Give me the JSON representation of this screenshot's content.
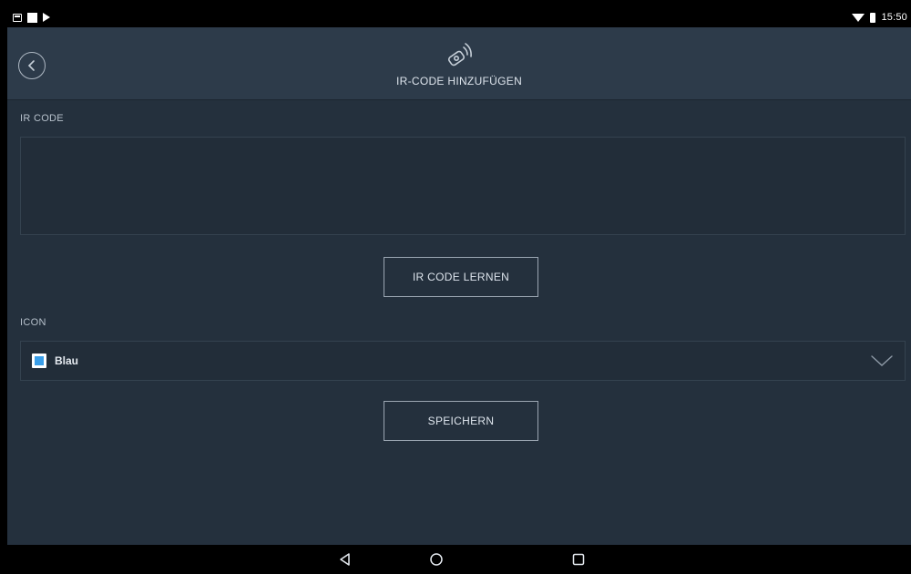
{
  "status_bar": {
    "time": "15:50",
    "icons": [
      "image-notification-icon",
      "square-notification-icon",
      "play-notification-icon",
      "wifi-icon",
      "battery-icon"
    ]
  },
  "header": {
    "title": "IR-CODE HINZUFÜGEN",
    "back_icon": "chevron-left-circle-icon",
    "header_icon": "ir-remote-icon"
  },
  "form": {
    "ir_code": {
      "label": "IR CODE",
      "value": "",
      "placeholder": ""
    },
    "learn_button": "IR CODE LERNEN",
    "icon": {
      "label": "ICON",
      "selected": "Blau",
      "swatch_color": "#3a9ee8"
    },
    "save_button": "SPEICHERN"
  },
  "colors": {
    "background": "#24303d",
    "header": "#2d3b4a",
    "field": "#222d39",
    "text": "#dde4ec"
  },
  "nav_bar": {
    "icons": [
      "nav-back-icon",
      "nav-home-icon",
      "nav-recents-icon"
    ]
  }
}
